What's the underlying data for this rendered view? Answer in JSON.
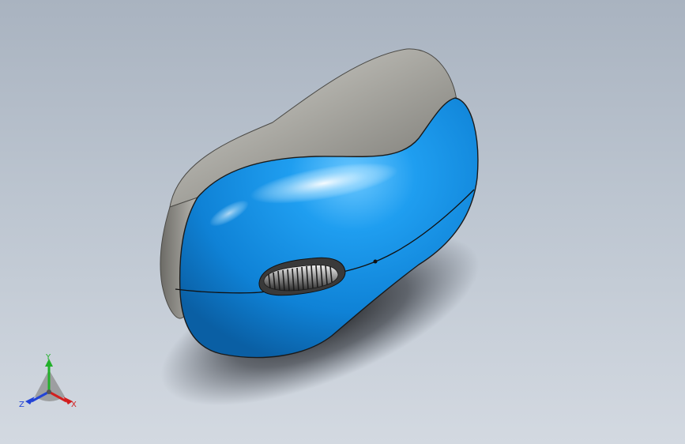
{
  "viewport": {
    "background_top": "#a9b3c0",
    "background_bottom": "#d3d9e1"
  },
  "model": {
    "body_color": "#1592e6",
    "shell_color": "#a9a8a3",
    "wheel_color": "#8a8a8a"
  },
  "triad": {
    "x_label": "X",
    "y_label": "Y",
    "z_label": "Z",
    "x_color": "#d21f1f",
    "y_color": "#22b02a",
    "z_color": "#2243d6"
  }
}
